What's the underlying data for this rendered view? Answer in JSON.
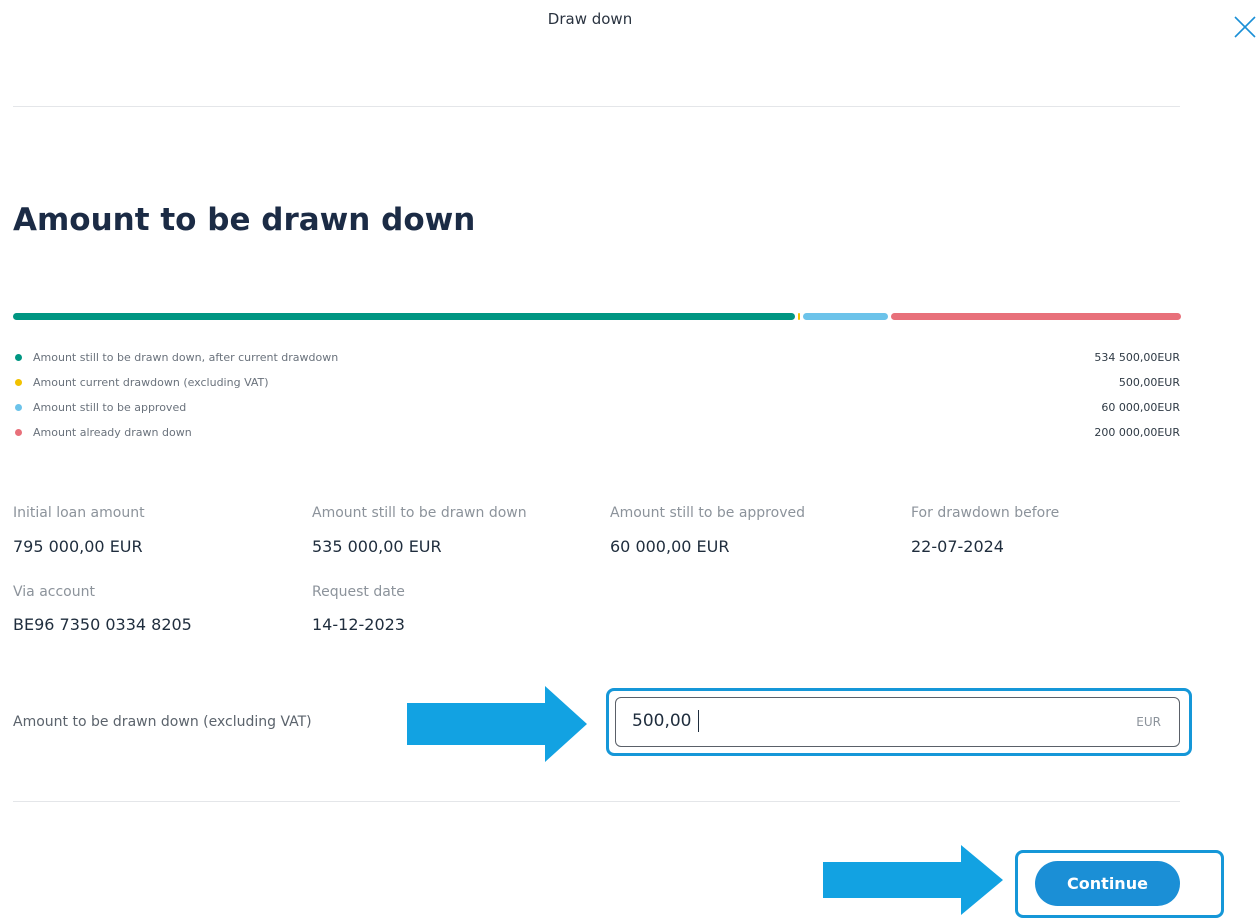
{
  "header": {
    "title": "Draw down"
  },
  "page": {
    "title": "Amount to be drawn down"
  },
  "progress": {
    "segments": [
      {
        "name": "Amount still to be drawn down, after current drawdown",
        "value": 534500.0,
        "color": "#009682"
      },
      {
        "name": "Amount current drawdown (excluding VAT)",
        "value": 500.0,
        "color": "#f2c200"
      },
      {
        "name": "Amount still to be approved",
        "value": 60000.0,
        "color": "#6cc3ea"
      },
      {
        "name": "Amount already drawn down",
        "value": 200000.0,
        "color": "#e8707a"
      }
    ]
  },
  "legend": {
    "items": [
      {
        "label": "Amount still to be drawn down, after current drawdown",
        "value": "534 500,00EUR",
        "color": "#009682"
      },
      {
        "label": "Amount current drawdown (excluding VAT)",
        "value": "500,00EUR",
        "color": "#f2c200"
      },
      {
        "label": "Amount still to be approved",
        "value": "60 000,00EUR",
        "color": "#6cc3ea"
      },
      {
        "label": "Amount already drawn down",
        "value": "200 000,00EUR",
        "color": "#e8707a"
      }
    ]
  },
  "details": {
    "initial_loan": {
      "label": "Initial loan amount",
      "value": "795 000,00 EUR"
    },
    "still_to_draw": {
      "label": "Amount still to be drawn down",
      "value": "535 000,00 EUR"
    },
    "still_to_approve": {
      "label": "Amount still to be approved",
      "value": "60 000,00 EUR"
    },
    "drawdown_before": {
      "label": "For drawdown before",
      "value": "22-07-2024"
    },
    "via_account": {
      "label": "Via account",
      "value": "BE96 7350 0334 8205"
    },
    "request_date": {
      "label": "Request date",
      "value": "14-12-2023"
    }
  },
  "amount_field": {
    "label": "Amount to be drawn down (excluding VAT)",
    "value": "500,00",
    "unit": "EUR"
  },
  "actions": {
    "continue_label": "Continue"
  },
  "colors": {
    "accent": "#1b8fd6",
    "annotation": "#1597d8",
    "title": "#1b2b45"
  },
  "icons": {
    "close": "close-icon",
    "annotation_arrow": "arrow-right-icon"
  }
}
